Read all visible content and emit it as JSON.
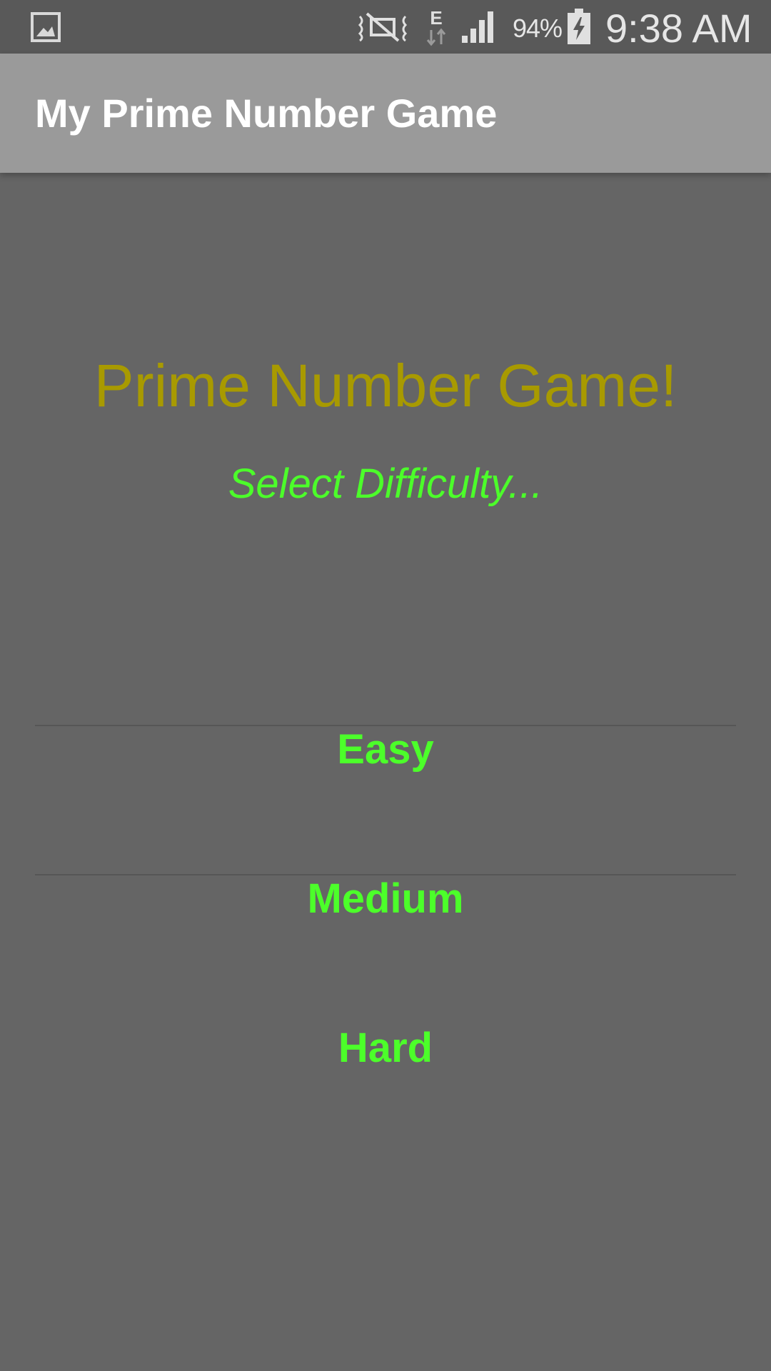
{
  "status_bar": {
    "battery_percent": "94%",
    "time": "9:38 AM",
    "network_type": "E",
    "icons": [
      "gallery-icon",
      "mute-icon",
      "data-arrows-icon",
      "signal-icon",
      "battery-charging-icon"
    ]
  },
  "app_bar": {
    "title": "My Prime Number Game",
    "background_color": "#9a9a9a"
  },
  "main": {
    "title": "Prime Number Game!",
    "subtitle": "Select Difficulty...",
    "options": [
      {
        "label": "Easy"
      },
      {
        "label": "Medium"
      },
      {
        "label": "Hard"
      }
    ],
    "title_color": "#a89a00",
    "accent_color": "#4cff2a",
    "background_color": "#656565"
  }
}
